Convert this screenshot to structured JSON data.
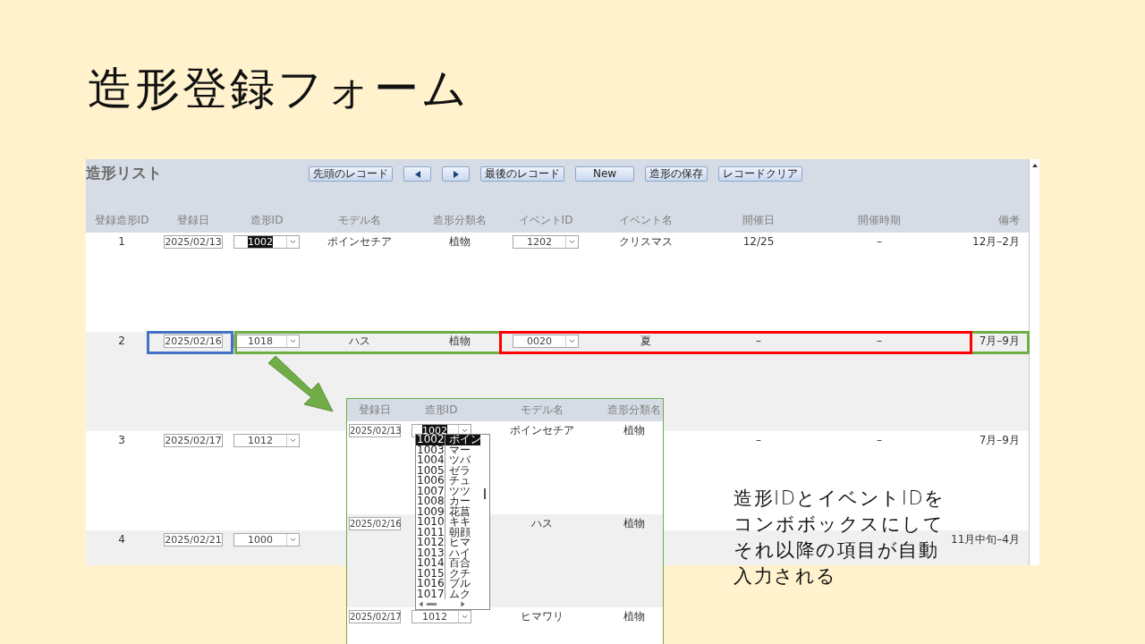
{
  "slide_title": "造形登録フォーム",
  "form": {
    "title": "造形リスト",
    "buttons": [
      {
        "kind": "text",
        "label": "先頭のレコード"
      },
      {
        "kind": "prev"
      },
      {
        "kind": "next"
      },
      {
        "kind": "text",
        "label": "最後のレコード"
      },
      {
        "kind": "text",
        "label": "New"
      },
      {
        "kind": "text",
        "label": "造形の保存"
      },
      {
        "kind": "text",
        "label": "レコードクリア"
      }
    ],
    "columns": [
      {
        "label": "登録造形ID",
        "kind": "text"
      },
      {
        "label": "登録日",
        "kind": "date"
      },
      {
        "label": "造形ID",
        "kind": "combo"
      },
      {
        "label": "モデル名",
        "kind": "text"
      },
      {
        "label": "造形分類名",
        "kind": "text"
      },
      {
        "label": "イベントID",
        "kind": "combo"
      },
      {
        "label": "イベント名",
        "kind": "text"
      },
      {
        "label": "開催日",
        "kind": "text"
      },
      {
        "label": "開催時期",
        "kind": "text"
      },
      {
        "label": "備考",
        "kind": "note"
      }
    ],
    "rows": [
      {
        "cells": [
          {
            "value": "1"
          },
          {
            "value": "2025/02/13"
          },
          {
            "value": "1002",
            "selected": true
          },
          {
            "value": "ポインセチア"
          },
          {
            "value": "植物"
          },
          {
            "value": "1202",
            "selected": false
          },
          {
            "value": "クリスマス"
          },
          {
            "value": "12/25"
          },
          {
            "value": "–"
          },
          {
            "value": "12月–2月"
          }
        ]
      },
      {
        "cells": [
          {
            "value": "2"
          },
          {
            "value": "2025/02/16"
          },
          {
            "value": "1018",
            "selected": false
          },
          {
            "value": "ハス"
          },
          {
            "value": "植物"
          },
          {
            "value": "0020",
            "selected": false
          },
          {
            "value": "夏"
          },
          {
            "value": "–"
          },
          {
            "value": "–"
          },
          {
            "value": "7月–9月"
          }
        ]
      },
      {
        "cells": [
          {
            "value": "3"
          },
          {
            "value": "2025/02/17"
          },
          {
            "value": "1012",
            "selected": false
          },
          null,
          null,
          null,
          null,
          {
            "value": "–"
          },
          {
            "value": "–"
          },
          {
            "value": "7月–9月"
          }
        ]
      },
      {
        "cells": [
          {
            "value": "4"
          },
          {
            "value": "2025/02/21"
          },
          {
            "value": "1000",
            "selected": false
          },
          null,
          null,
          null,
          null,
          null,
          null,
          {
            "value": "11月中旬–4月"
          }
        ]
      }
    ]
  },
  "highlights": [
    {
      "color": "#70ad47"
    },
    {
      "color": "#ff0000"
    },
    {
      "color": "#4472c4"
    }
  ],
  "inset": {
    "columns": [
      "登録日",
      "造形ID",
      "モデル名",
      "造形分類名"
    ],
    "rows": [
      {
        "date": "2025/02/13",
        "model_id": {
          "value": "1002",
          "selected": true
        },
        "model_name": "ポインセチア",
        "category": "植物"
      },
      {
        "date": "2025/02/16",
        "model_name": "ハス",
        "category": "植物"
      },
      {
        "date": "2025/02/17",
        "model_id": {
          "value": "1012",
          "selected": false
        },
        "model_name": "ヒマワリ",
        "category": "植物"
      }
    ],
    "dropdown": [
      {
        "id": "1002",
        "name": "ポイン",
        "selected": true
      },
      {
        "id": "1003",
        "name": "マー",
        "selected": false
      },
      {
        "id": "1004",
        "name": "ツバ",
        "selected": false
      },
      {
        "id": "1005",
        "name": "ゼラ",
        "selected": false
      },
      {
        "id": "1006",
        "name": "チュ",
        "selected": false
      },
      {
        "id": "1007",
        "name": "ツツ",
        "selected": false
      },
      {
        "id": "1008",
        "name": "カー",
        "selected": false
      },
      {
        "id": "1009",
        "name": "花菖",
        "selected": false
      },
      {
        "id": "1010",
        "name": "キキ",
        "selected": false
      },
      {
        "id": "1011",
        "name": "朝顔",
        "selected": false
      },
      {
        "id": "1012",
        "name": "ヒマ",
        "selected": false
      },
      {
        "id": "1013",
        "name": "ハイ",
        "selected": false
      },
      {
        "id": "1014",
        "name": "百合",
        "selected": false
      },
      {
        "id": "1015",
        "name": "クチ",
        "selected": false
      },
      {
        "id": "1016",
        "name": "ブル",
        "selected": false
      },
      {
        "id": "1017",
        "name": "ムク",
        "selected": false
      }
    ]
  },
  "note": [
    "造形IDとイベントIDを",
    "コンボボックスにして",
    "それ以降の項目が自動",
    "入力される"
  ]
}
